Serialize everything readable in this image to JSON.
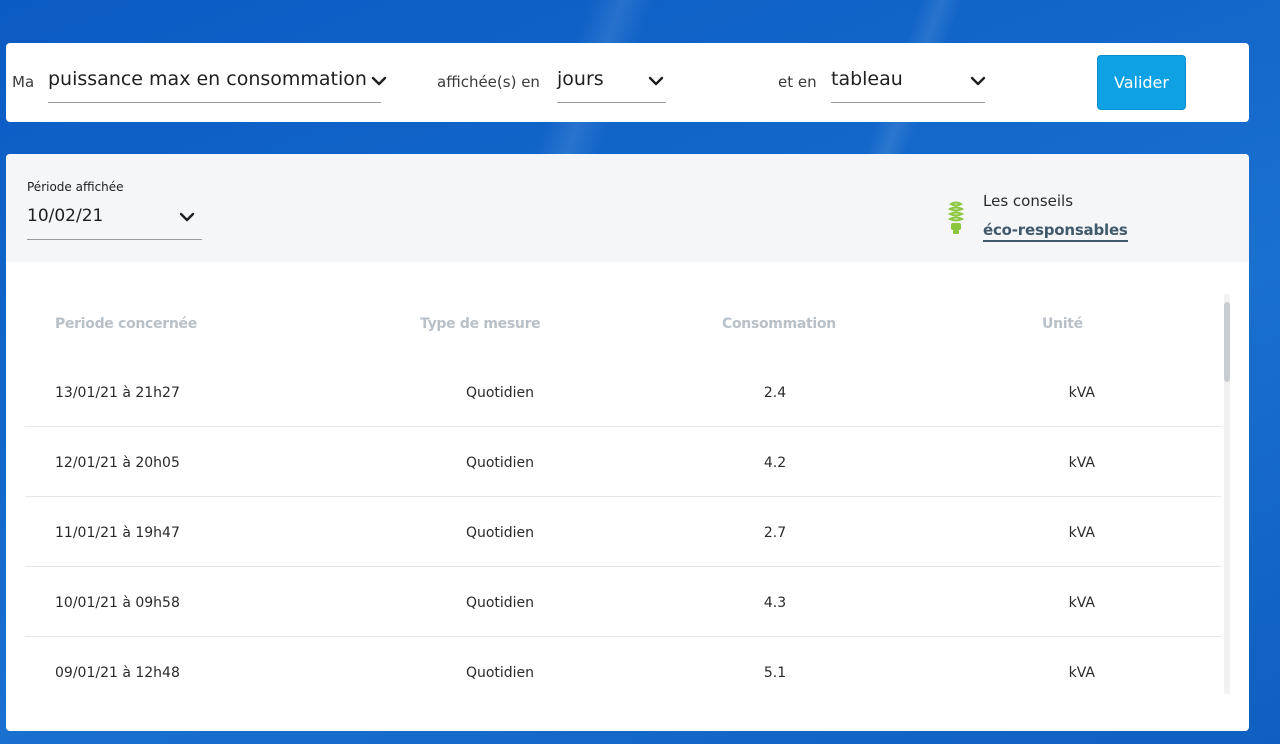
{
  "filters": {
    "prefix": "Ma",
    "metric_value": "puissance max en consommation",
    "displayed_in_label": "affichée(s) en",
    "granularity_value": "jours",
    "and_in_label": "et en",
    "view_value": "tableau",
    "submit_label": "Valider"
  },
  "period": {
    "label": "Période affichée",
    "value": "10/02/21"
  },
  "eco_tips": {
    "line1": "Les conseils",
    "link": "éco-responsables",
    "icon": "lightbulb-icon",
    "icon_color": "#8cc63f"
  },
  "table": {
    "headers": [
      "Periode concernée",
      "Type de mesure",
      "Consommation",
      "Unité"
    ],
    "rows": [
      {
        "period": "13/01/21 à 21h27",
        "type": "Quotidien",
        "value": "2.4",
        "unit": "kVA"
      },
      {
        "period": "12/01/21 à 20h05",
        "type": "Quotidien",
        "value": "4.2",
        "unit": "kVA"
      },
      {
        "period": "11/01/21 à 19h47",
        "type": "Quotidien",
        "value": "2.7",
        "unit": "kVA"
      },
      {
        "period": "10/01/21 à 09h58",
        "type": "Quotidien",
        "value": "4.3",
        "unit": "kVA"
      },
      {
        "period": "09/01/21 à 12h48",
        "type": "Quotidien",
        "value": "5.1",
        "unit": "kVA"
      }
    ]
  },
  "colors": {
    "accent": "#0ea1e4",
    "background": "#0f63c6"
  }
}
